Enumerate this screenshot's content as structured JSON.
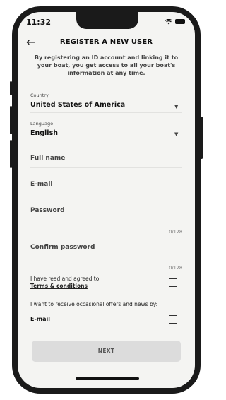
{
  "status_bar": {
    "time": "11:32",
    "signal_dots": "....",
    "wifi_icon": "wifi-icon",
    "battery_icon": "battery-icon"
  },
  "header": {
    "back_icon": "←",
    "title": "REGISTER A NEW USER"
  },
  "intro": "By registering an ID account and linking it to your boat, you get access to all your boat's information at any time.",
  "form": {
    "country": {
      "label": "Country",
      "value": "United States of America",
      "caret": "▼"
    },
    "language": {
      "label": "Language",
      "value": "English",
      "caret": "▼"
    },
    "full_name": {
      "placeholder": "Full name"
    },
    "email": {
      "placeholder": "E-mail"
    },
    "password": {
      "placeholder": "Password",
      "counter": "0/128"
    },
    "confirm_password": {
      "placeholder": "Confirm password",
      "counter": "0/128"
    },
    "terms": {
      "line1": "I have read and agreed to",
      "link": "Terms & conditions",
      "checked": false
    },
    "offers": {
      "text": "I want to receive occasional offers and news by:",
      "email_label": "E-mail",
      "checked": false
    }
  },
  "next_label": "NEXT"
}
